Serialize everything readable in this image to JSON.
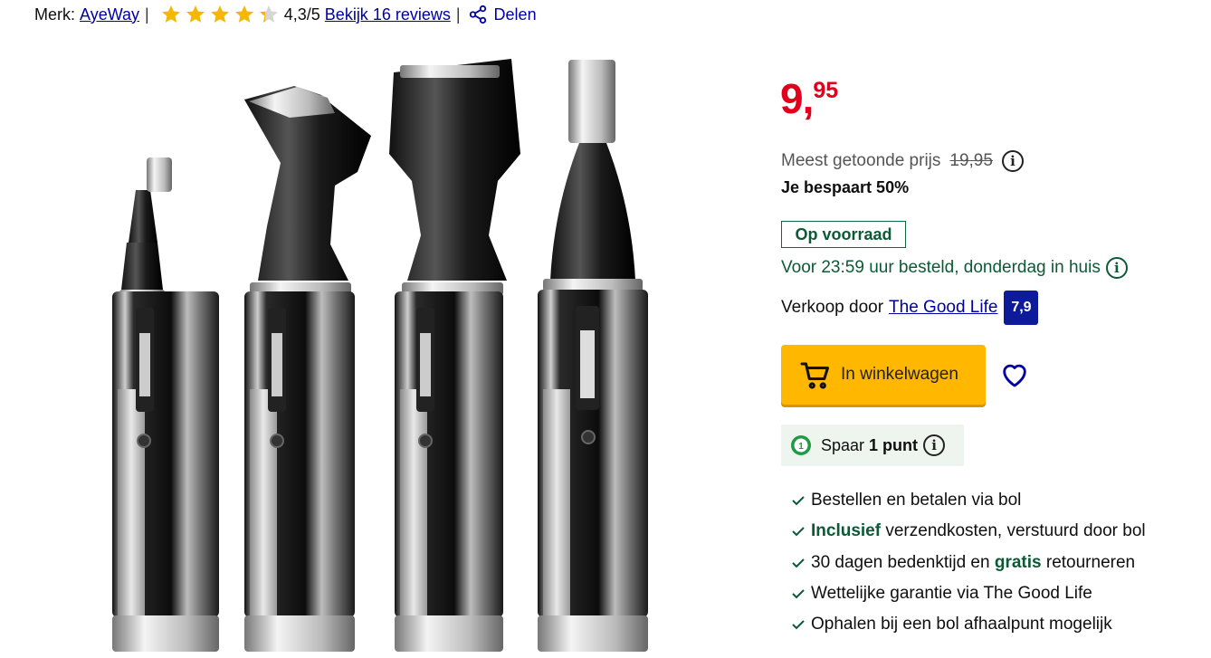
{
  "header": {
    "brand_label": "Merk:",
    "brand_name": "AyeWay",
    "rating_score": "4,3/5",
    "rating_value": 4.3,
    "rating_max": 5,
    "reviews_link": "Bekijk 16 reviews",
    "share_label": "Delen",
    "separator": "|"
  },
  "product_image": {
    "icon": "product-photo-nose-trimmer-set"
  },
  "buy_block": {
    "price_int": "9,",
    "price_frac": "95",
    "was_label": "Meest getoonde prijs",
    "was_price": "19,95",
    "saving": "Je bespaart 50%",
    "stock_badge": "Op voorraad",
    "delivery": "Voor 23:59 uur besteld, donderdag in huis",
    "seller_label": "Verkoop door",
    "seller_name": "The Good Life",
    "seller_rating": "7,9",
    "cart_button": "In winkelwagen",
    "points_prefix": "Spaar",
    "points_value": "1 punt",
    "info_glyph": "i"
  },
  "usps": [
    {
      "bold": "",
      "text": "Bestellen en betalen via bol"
    },
    {
      "bold": "Inclusief",
      "text": " verzendkosten, verstuurd door bol"
    },
    {
      "pre": "30 dagen bedenktijd en ",
      "bold": "gratis",
      "text": " retourneren"
    },
    {
      "bold": "",
      "text": "Wettelijke garantie via The Good Life"
    },
    {
      "bold": "",
      "text": "Ophalen bij een bol afhaalpunt mogelijk"
    }
  ],
  "colors": {
    "price_red": "#e0001b",
    "link_blue": "#0000a4",
    "stock_green": "#0b5a35",
    "cart_yellow": "#ffb700",
    "rating_navy": "#0d1a9a",
    "star_yellow": "#f5b800"
  }
}
